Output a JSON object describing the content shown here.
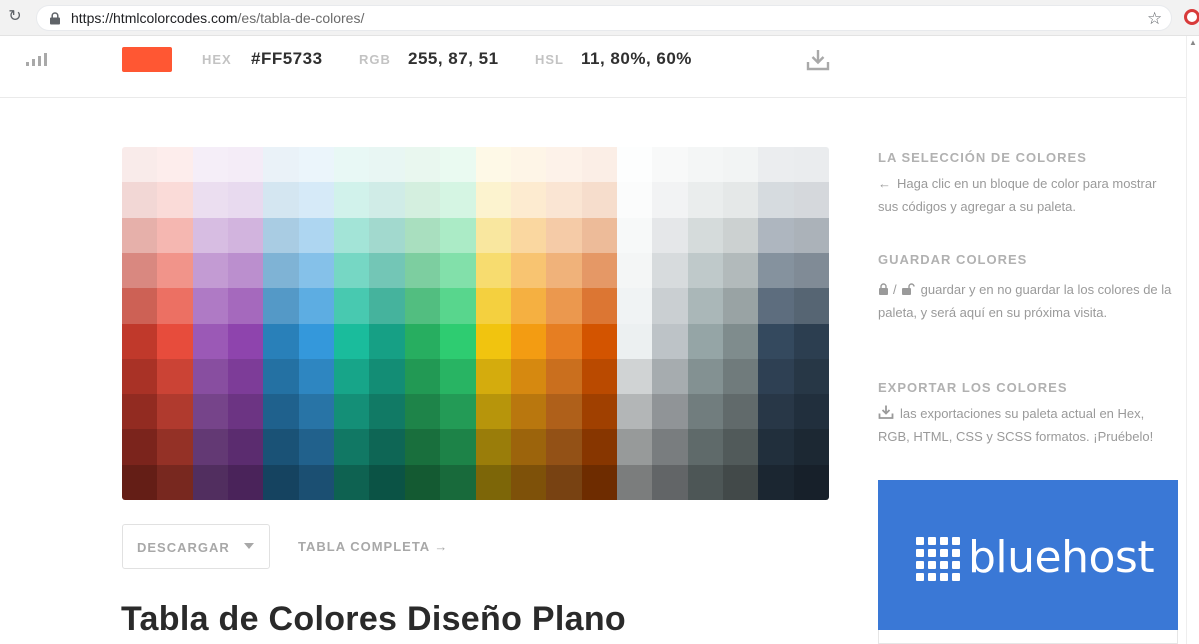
{
  "browser": {
    "url_host": "https://htmlcolorcodes.com",
    "url_path": "/es/tabla-de-colores/"
  },
  "colorbar": {
    "swatch_color": "#FF5733",
    "hex_label": "HEX",
    "hex_value": "#FF5733",
    "rgb_label": "RGB",
    "rgb_value": "255, 87, 51",
    "hsl_label": "HSL",
    "hsl_value": "11, 80%, 60%"
  },
  "palette": {
    "columns": [
      [
        "#f9ebea",
        "#f2d7d5",
        "#e6b0aa",
        "#d98880",
        "#cd6155",
        "#c0392b",
        "#a93226",
        "#922b21",
        "#7b241c",
        "#641e16"
      ],
      [
        "#fdedec",
        "#fadbd8",
        "#f5b7b1",
        "#f1948a",
        "#ec7063",
        "#e74c3c",
        "#cb4335",
        "#b03a2e",
        "#943126",
        "#78281f"
      ],
      [
        "#f5eef8",
        "#ebdef0",
        "#d7bde2",
        "#c39bd3",
        "#af7ac5",
        "#9b59b6",
        "#884ea0",
        "#76448a",
        "#633974",
        "#512e5f"
      ],
      [
        "#f4ecf7",
        "#e8daef",
        "#d2b4de",
        "#bb8fce",
        "#a569bd",
        "#8e44ad",
        "#7d3c98",
        "#6c3483",
        "#5b2c6f",
        "#4a235a"
      ],
      [
        "#eaf2f8",
        "#d4e6f1",
        "#a9cce3",
        "#7fb3d5",
        "#5499c7",
        "#2980b9",
        "#2471a3",
        "#1f618d",
        "#1a5276",
        "#154360"
      ],
      [
        "#ebf5fb",
        "#d6eaf8",
        "#aed6f1",
        "#85c1e9",
        "#5dade2",
        "#3498db",
        "#2e86c1",
        "#2874a6",
        "#21618c",
        "#1b4f72"
      ],
      [
        "#e8f8f5",
        "#d1f2eb",
        "#a3e4d7",
        "#76d7c4",
        "#48c9b0",
        "#1abc9c",
        "#17a589",
        "#148f77",
        "#117864",
        "#0e6251"
      ],
      [
        "#e8f6f3",
        "#d0ece7",
        "#a2d9ce",
        "#73c6b6",
        "#45b39d",
        "#16a085",
        "#138d75",
        "#117a65",
        "#0e6655",
        "#0b5345"
      ],
      [
        "#e9f7ef",
        "#d4efdf",
        "#a9dfbf",
        "#7dcea0",
        "#52be80",
        "#27ae60",
        "#229954",
        "#1e8449",
        "#196f3d",
        "#145a32"
      ],
      [
        "#eafaf1",
        "#d5f5e3",
        "#abebc6",
        "#82e0aa",
        "#58d68d",
        "#2ecc71",
        "#28b463",
        "#239b56",
        "#1d8348",
        "#186a3b"
      ],
      [
        "#fef9e7",
        "#fcf3cf",
        "#f9e79f",
        "#f7dc6f",
        "#f4d03f",
        "#f1c40f",
        "#d4ac0d",
        "#b7950b",
        "#9a7d0a",
        "#7d6608"
      ],
      [
        "#fef5e7",
        "#fdebd0",
        "#fad7a0",
        "#f8c471",
        "#f5b041",
        "#f39c12",
        "#d68910",
        "#b9770e",
        "#9c640c",
        "#7e5109"
      ],
      [
        "#fdf2e9",
        "#fae5d3",
        "#f5cba7",
        "#f0b27a",
        "#eb984e",
        "#e67e22",
        "#ca6f1e",
        "#af601a",
        "#935116",
        "#784212"
      ],
      [
        "#fbeee6",
        "#f6ddcc",
        "#edbb99",
        "#e59866",
        "#dc7633",
        "#d35400",
        "#ba4a00",
        "#a04000",
        "#873600",
        "#6e2c00"
      ],
      [
        "#fdfefe",
        "#fbfcfc",
        "#f7f9f9",
        "#f4f6f6",
        "#f0f3f4",
        "#ecf0f1",
        "#d0d3d4",
        "#b3b6b7",
        "#979a9a",
        "#7b7d7d"
      ],
      [
        "#f8f9f9",
        "#f2f3f4",
        "#e5e7e9",
        "#d7dbdd",
        "#cacfd2",
        "#bdc3c7",
        "#a6acaf",
        "#909497",
        "#797d7f",
        "#626567"
      ],
      [
        "#f4f6f6",
        "#eaeded",
        "#d5dbdb",
        "#bfc9ca",
        "#aab7b8",
        "#95a5a6",
        "#839192",
        "#717d7e",
        "#5f6a6a",
        "#4d5656"
      ],
      [
        "#f2f4f4",
        "#e5e8e8",
        "#ccd1d1",
        "#b2babb",
        "#99a3a4",
        "#7f8c8d",
        "#707b7c",
        "#616a6b",
        "#515a5a",
        "#424949"
      ],
      [
        "#ebedef",
        "#d6dbdf",
        "#aeb6bf",
        "#85929e",
        "#5d6d7e",
        "#34495e",
        "#2e4053",
        "#283747",
        "#212f3c",
        "#1b2631"
      ],
      [
        "#eaecee",
        "#d5d8dc",
        "#abb2b9",
        "#808b96",
        "#566573",
        "#2c3e50",
        "#273746",
        "#212f3d",
        "#1c2833",
        "#17202a"
      ]
    ]
  },
  "controls": {
    "descargar_label": "DESCARGAR",
    "tabla_link": "TABLA COMPLETA →"
  },
  "page": {
    "title": "Tabla de Colores Diseño Plano"
  },
  "sidebar": {
    "seleccion_heading": "LA SELECCIÓN DE COLORES",
    "seleccion_text": "Haga clic en un bloque de color para mostrar sus códigos y agregar a su paleta.",
    "guardar_heading": "GUARDAR COLORES",
    "guardar_sep": "/",
    "guardar_text": "guardar y en no guardar la los colores de la paleta, y será aquí en su próxima visita.",
    "exportar_heading": "EXPORTAR LOS COLORES",
    "exportar_text": "las exportaciones su paleta actual en Hex, RGB, HTML, CSS y SCSS formatos. ¡Pruébelo!"
  },
  "ad": {
    "brand": "bluehost",
    "background": "#3a78d6"
  }
}
